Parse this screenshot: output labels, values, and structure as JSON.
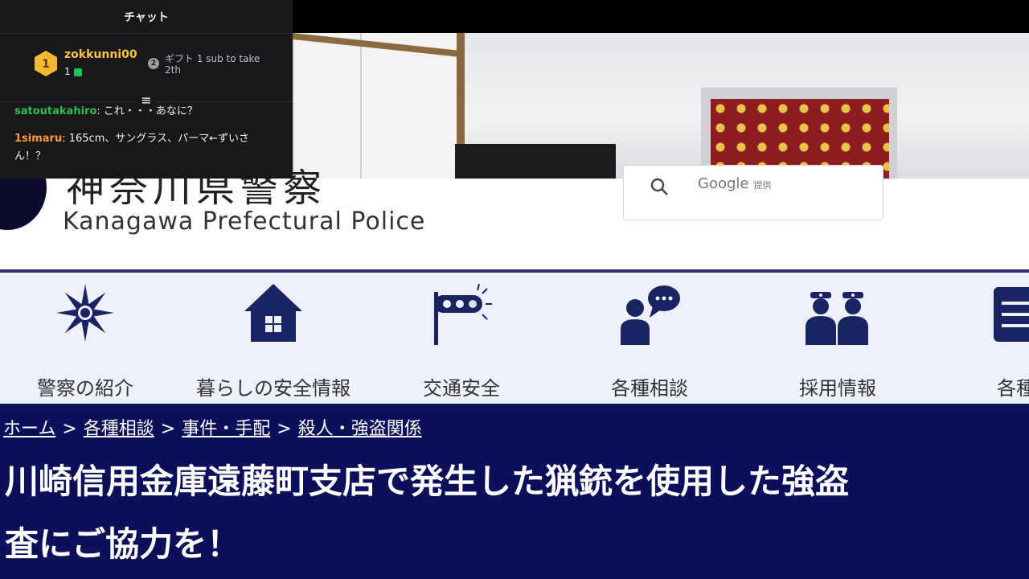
{
  "chat": {
    "title": "チャット",
    "gift": {
      "rank1": "1",
      "user": "zokkunni00",
      "count": "1",
      "rank2": "2",
      "text": "ギフト 1 sub to take 2th"
    },
    "messages": [
      {
        "user": "satoutakahiro",
        "text": ": これ・・・あなに？"
      },
      {
        "user": "1simaru",
        "text": ": 165cm、サングラス、パーマ←ずいさん！？"
      }
    ]
  },
  "site": {
    "title_jp": "神奈川県警察",
    "title_en": "Kanagawa Prefectural Police",
    "search": {
      "placeholder": "Google",
      "provided": "提供"
    },
    "nav": [
      {
        "label": "警察の紹介",
        "icon": "police-emblem-icon"
      },
      {
        "label": "暮らしの安全情報",
        "icon": "house-icon"
      },
      {
        "label": "交通安全",
        "icon": "traffic-light-icon"
      },
      {
        "label": "各種相談",
        "icon": "consultation-icon"
      },
      {
        "label": "採用情報",
        "icon": "police-officers-icon"
      },
      {
        "label": "各種手",
        "icon": "list-icon"
      }
    ],
    "breadcrumb": [
      "ホーム",
      "各種相談",
      "事件・手配",
      "殺人・強盗関係"
    ],
    "breadcrumb_sep": ">",
    "article_title_line1": "川崎信用金庫遠藤町支店で発生した猟銃を使用した強盗",
    "article_title_line2": "査にご協力を！"
  },
  "colors": {
    "nav_bg": "#eef1fb",
    "heading_bg": "#0c0f5a",
    "icon_navy": "#1b2462",
    "chat_bg": "#18181b"
  }
}
